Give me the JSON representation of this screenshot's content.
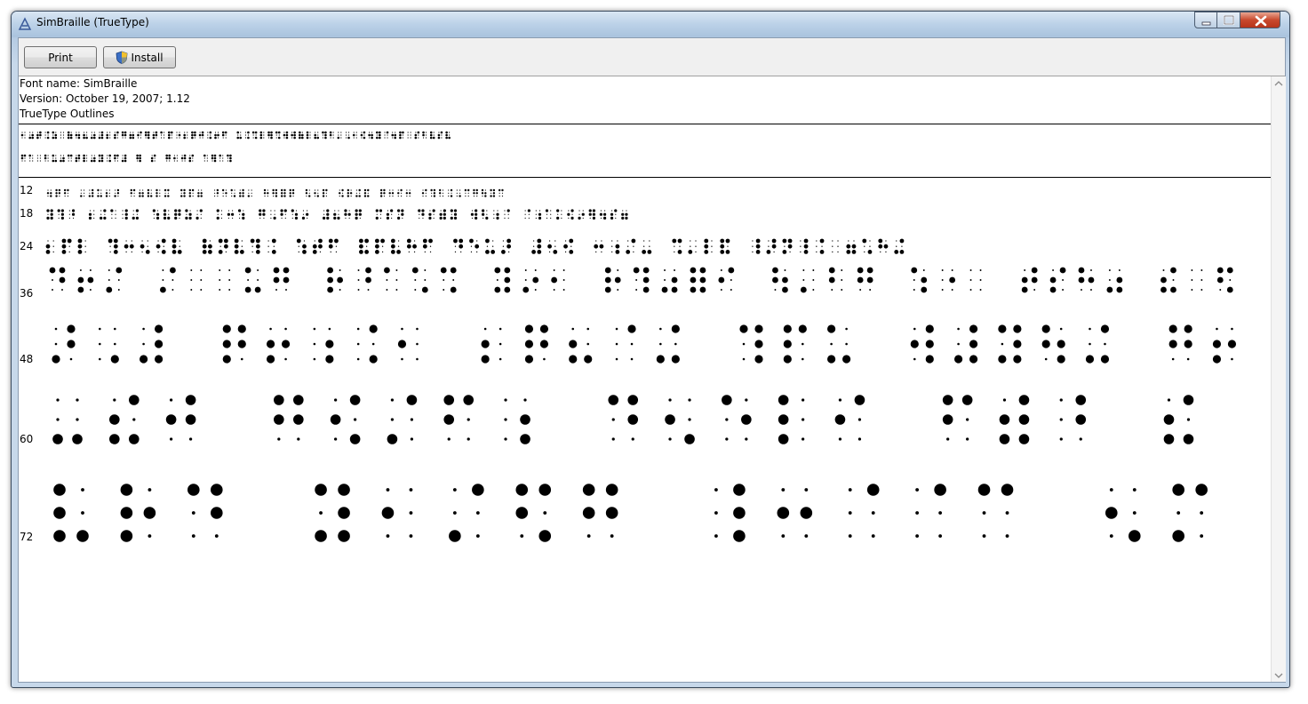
{
  "window": {
    "title": "SimBraille (TrueType)"
  },
  "toolbar": {
    "print_label": "Print",
    "install_label": "Install"
  },
  "info": {
    "font_name": "Font name: SimBraille",
    "version": "Version: October 19, 2007; 1.12",
    "outlines": "TrueType Outlines"
  },
  "sample_sizes": [
    "12",
    "18",
    "24",
    "36",
    "48",
    "60",
    "72"
  ],
  "colors": {
    "text": "#000000",
    "background": "#ffffff",
    "titlebar": "#bcd2e8",
    "close_button": "#c8492d"
  }
}
